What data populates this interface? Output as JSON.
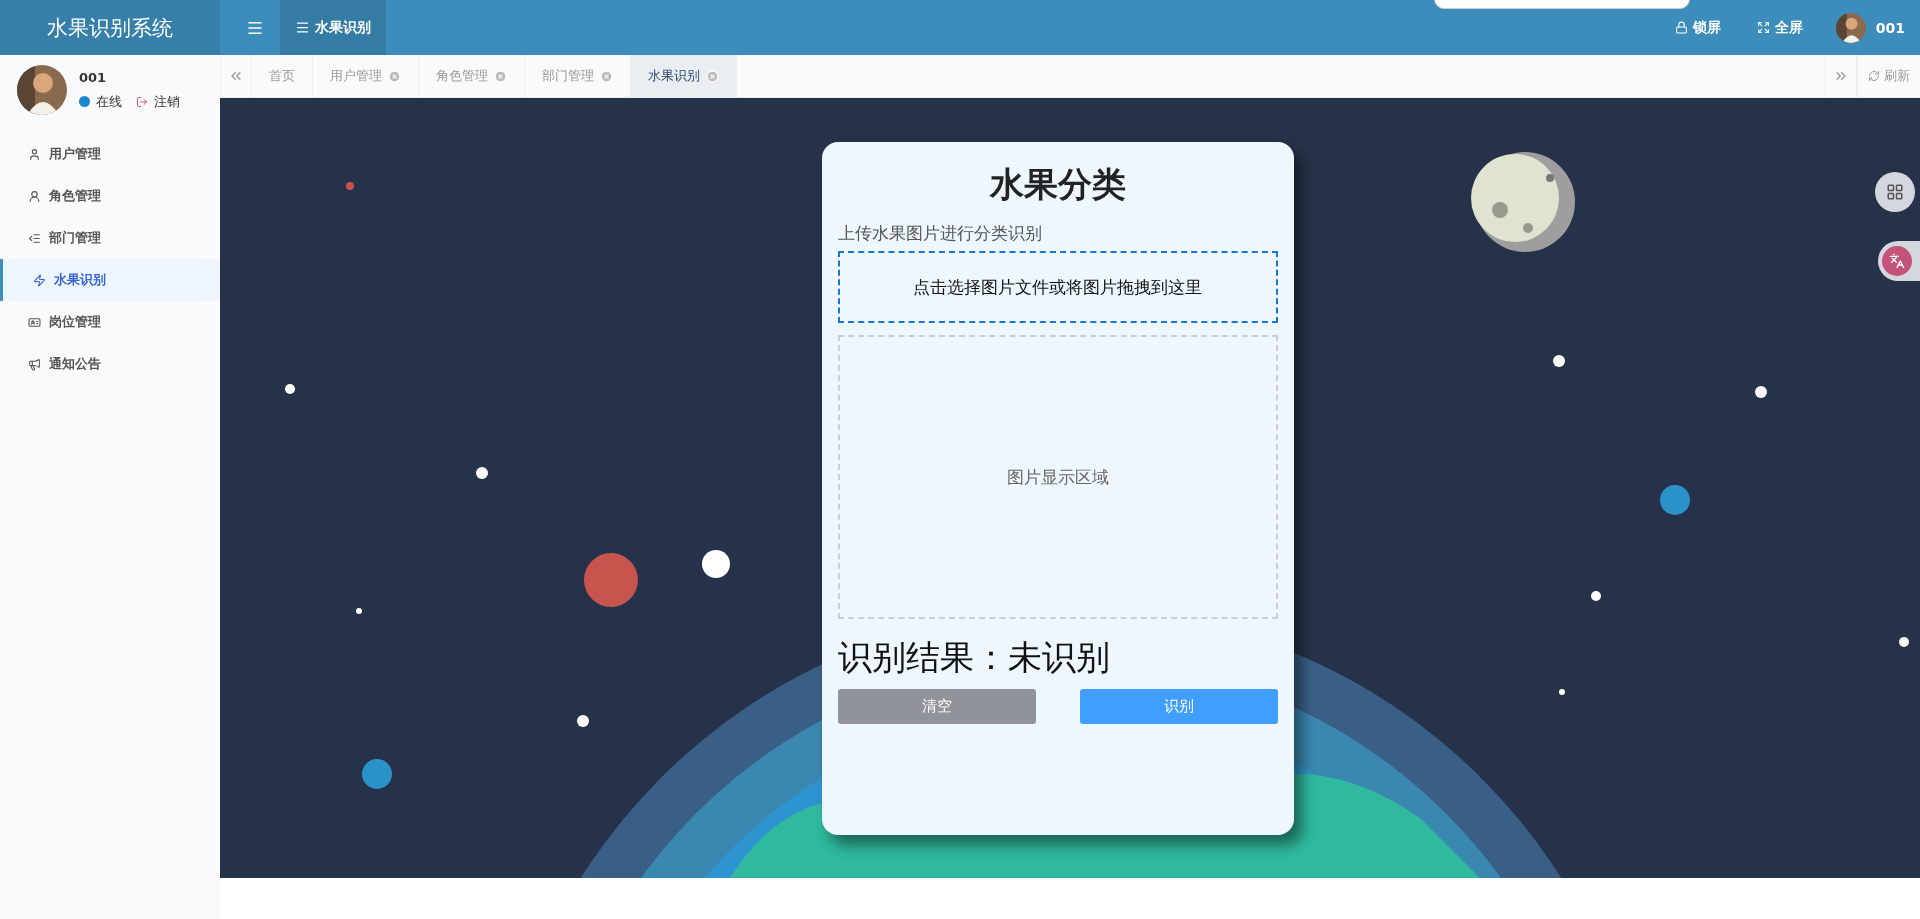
{
  "app_title": "水果识别系统",
  "top_nav": [
    {
      "label": "水果识别",
      "selected": true
    }
  ],
  "header_actions": [
    {
      "kind": "lock",
      "label": "锁屏"
    },
    {
      "kind": "fullscreen",
      "label": "全屏"
    }
  ],
  "header_user": "001",
  "user": {
    "name": "001",
    "status": "在线",
    "logout": "注销"
  },
  "sidebar": {
    "items": [
      {
        "label": "用户管理",
        "selected": false
      },
      {
        "label": "角色管理",
        "selected": false
      },
      {
        "label": "部门管理",
        "selected": false
      },
      {
        "label": "水果识别",
        "selected": true
      },
      {
        "label": "岗位管理",
        "selected": false
      },
      {
        "label": "通知公告",
        "selected": false
      }
    ]
  },
  "tabs": [
    {
      "label": "首页",
      "selected": false,
      "closable": false
    },
    {
      "label": "用户管理",
      "selected": false,
      "closable": true
    },
    {
      "label": "角色管理",
      "selected": false,
      "closable": true
    },
    {
      "label": "部门管理",
      "selected": false,
      "closable": true
    },
    {
      "label": "水果识别",
      "selected": true,
      "closable": true
    }
  ],
  "refresh": "刷新",
  "card": {
    "title": "水果分类",
    "subtitle": "上传水果图片进行分类识别",
    "upload_hint": "点击选择图片文件或将图片拖拽到这里",
    "preview_placeholder": "图片显示区域",
    "result": "识别结果：未识别",
    "buttons": [
      {
        "kind": "secondary",
        "label": "清空"
      },
      {
        "kind": "primary",
        "label": "识别"
      }
    ]
  }
}
